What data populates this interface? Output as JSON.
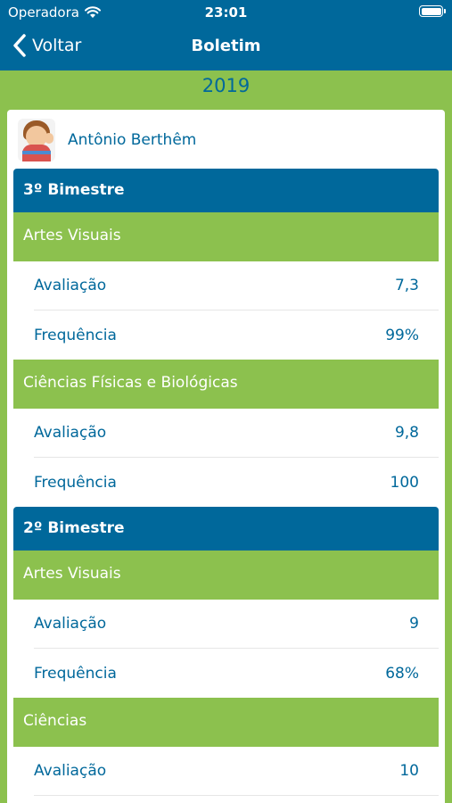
{
  "status": {
    "carrier": "Operadora",
    "time": "23:01"
  },
  "nav": {
    "back_label": "Voltar",
    "title": "Boletim"
  },
  "year": "2019",
  "student": {
    "name": "Antônio Berthêm"
  },
  "bimestres": [
    {
      "title": "3º Bimestre",
      "subjects": [
        {
          "name": "Artes Visuais",
          "rows": [
            {
              "label": "Avaliação",
              "value": "7,3"
            },
            {
              "label": "Frequência",
              "value": "99%"
            }
          ]
        },
        {
          "name": "Ciências Físicas e Biológicas",
          "rows": [
            {
              "label": "Avaliação",
              "value": "9,8"
            },
            {
              "label": "Frequência",
              "value": "100"
            }
          ]
        }
      ]
    },
    {
      "title": "2º Bimestre",
      "subjects": [
        {
          "name": "Artes Visuais",
          "rows": [
            {
              "label": "Avaliação",
              "value": "9"
            },
            {
              "label": "Frequência",
              "value": "68%"
            }
          ]
        },
        {
          "name": "Ciências",
          "rows": [
            {
              "label": "Avaliação",
              "value": "10"
            }
          ]
        }
      ]
    }
  ],
  "colors": {
    "primary": "#00689b",
    "accent": "#8cc14e"
  }
}
